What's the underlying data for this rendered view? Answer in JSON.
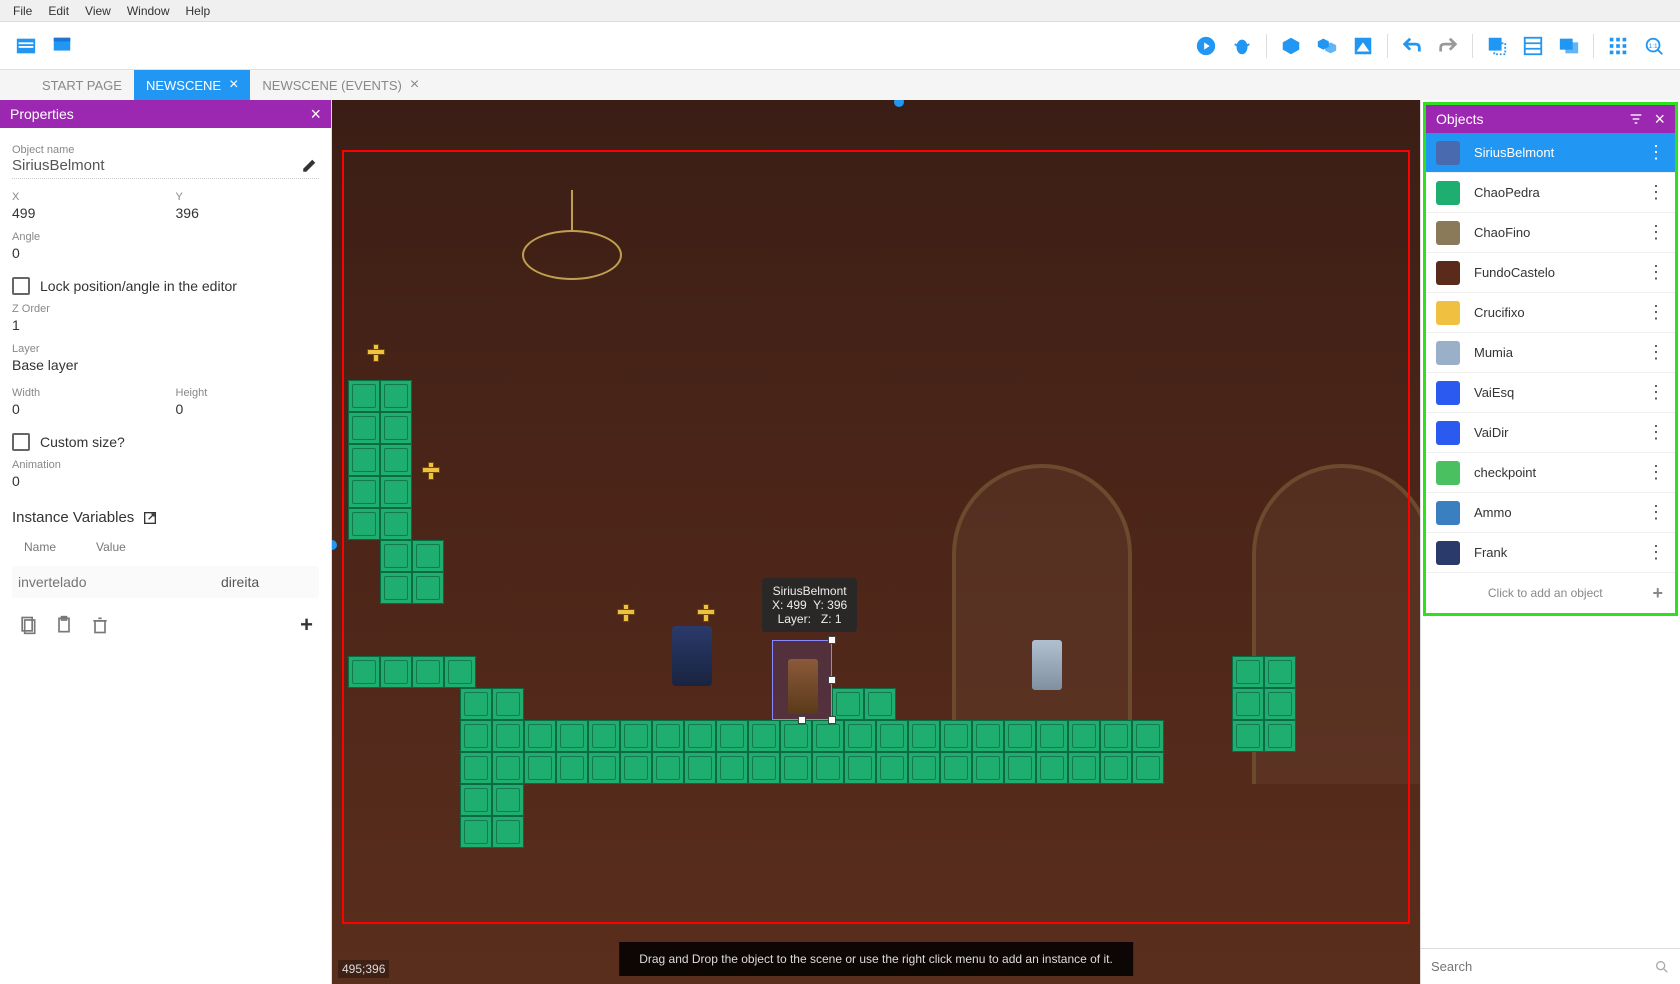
{
  "menubar": {
    "items": [
      "File",
      "Edit",
      "View",
      "Window",
      "Help"
    ]
  },
  "tabs": {
    "items": [
      {
        "label": "START PAGE",
        "active": false,
        "closeable": false
      },
      {
        "label": "NEWSCENE",
        "active": true,
        "closeable": true
      },
      {
        "label": "NEWSCENE (EVENTS)",
        "active": false,
        "closeable": true
      }
    ]
  },
  "properties": {
    "title": "Properties",
    "labels": {
      "object_name": "Object name",
      "x": "X",
      "y": "Y",
      "angle": "Angle",
      "lock": "Lock position/angle in the editor",
      "zorder": "Z Order",
      "layer": "Layer",
      "width": "Width",
      "height": "Height",
      "custom_size": "Custom size?",
      "animation": "Animation",
      "instance_variables": "Instance Variables",
      "var_name": "Name",
      "var_value": "Value"
    },
    "values": {
      "object_name": "SiriusBelmont",
      "x": "499",
      "y": "396",
      "angle": "0",
      "lock": false,
      "zorder": "1",
      "layer": "Base layer",
      "width": "0",
      "height": "0",
      "custom_size": false,
      "animation": "0"
    },
    "variables": [
      {
        "name_placeholder": "invertelado",
        "value": "direita"
      }
    ]
  },
  "canvas": {
    "tooltip": "SiriusBelmont\nX: 499  Y: 396\nLayer:   Z: 1",
    "hint": "Drag and Drop the object to the scene or use the right click menu to add an instance of it.",
    "cursor_coords": "495;396"
  },
  "objects": {
    "title": "Objects",
    "add_label": "Click to add an object",
    "search_placeholder": "Search",
    "items": [
      {
        "name": "SiriusBelmont",
        "selected": true,
        "thumb_color": "#4a6ab0"
      },
      {
        "name": "ChaoPedra",
        "selected": false,
        "thumb_color": "#1eae6f"
      },
      {
        "name": "ChaoFino",
        "selected": false,
        "thumb_color": "#8a7a5a"
      },
      {
        "name": "FundoCastelo",
        "selected": false,
        "thumb_color": "#5a2a1a"
      },
      {
        "name": "Crucifixo",
        "selected": false,
        "thumb_color": "#f0c040"
      },
      {
        "name": "Mumia",
        "selected": false,
        "thumb_color": "#9ab0c8"
      },
      {
        "name": "VaiEsq",
        "selected": false,
        "thumb_color": "#2a5af0"
      },
      {
        "name": "VaiDir",
        "selected": false,
        "thumb_color": "#2a5af0"
      },
      {
        "name": "checkpoint",
        "selected": false,
        "thumb_color": "#4ac060"
      },
      {
        "name": "Ammo",
        "selected": false,
        "thumb_color": "#3a80c0"
      },
      {
        "name": "Frank",
        "selected": false,
        "thumb_color": "#2a3a6a"
      }
    ]
  }
}
